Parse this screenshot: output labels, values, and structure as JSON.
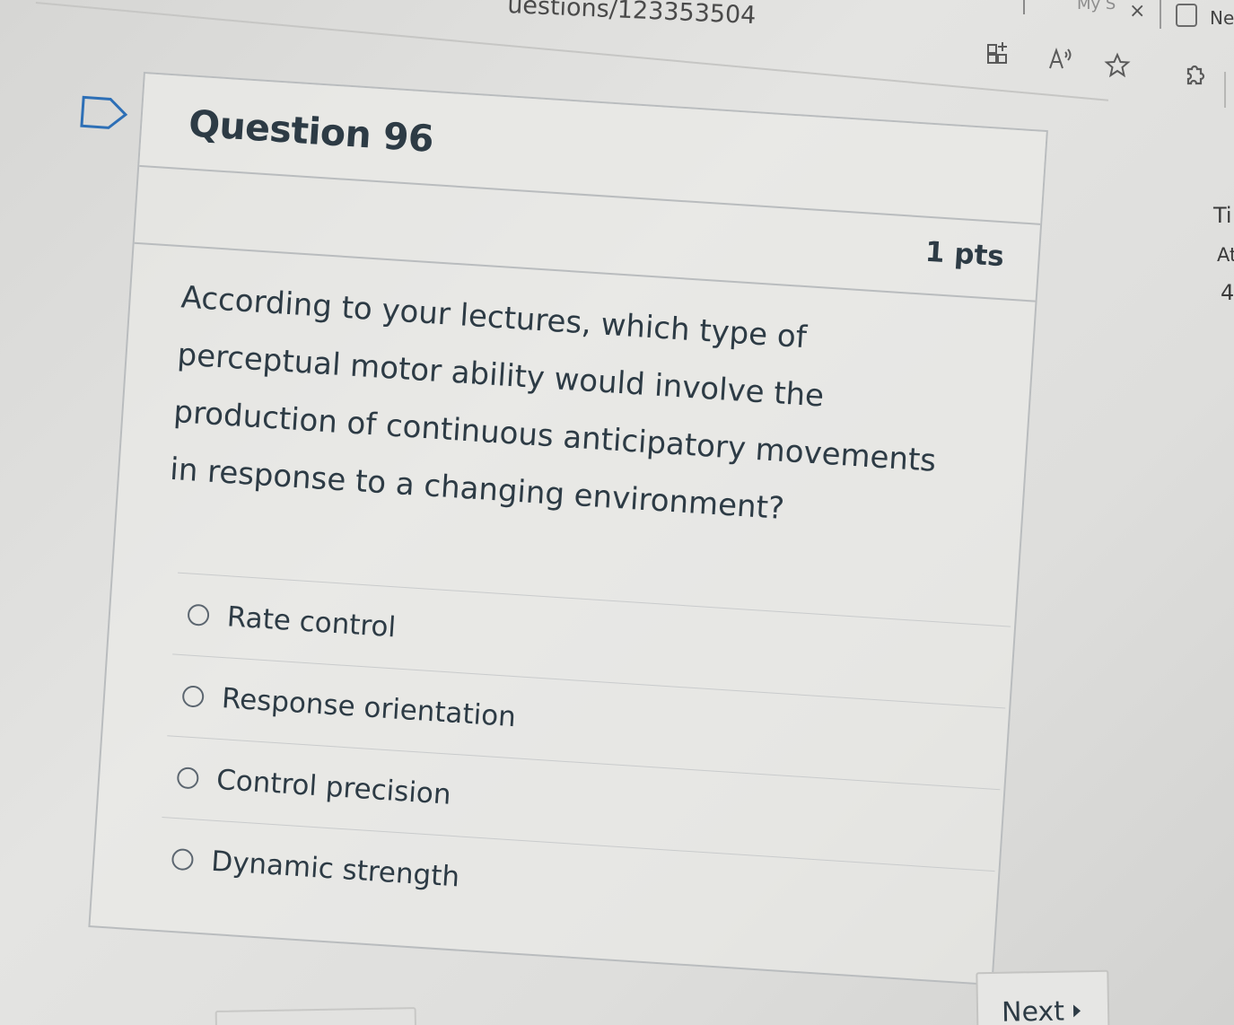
{
  "browser": {
    "url_fragment": "uestions/123353504",
    "tab_label_fragment": "My S",
    "close_glyph": "×",
    "new_tab_label": "Ne"
  },
  "toolbar": {
    "icons": [
      "app-grid-icon",
      "read-aloud-icon",
      "favorite-star-icon",
      "extensions-icon"
    ],
    "read_aloud_glyph": "A"
  },
  "question": {
    "title": "Question 96",
    "points": "1 pts",
    "text": "According to your lectures, which type of perceptual motor ability would involve the production of continuous anticipatory movements in response to a changing environment?",
    "answers": [
      {
        "label": "Rate control",
        "selected": false
      },
      {
        "label": "Response orientation",
        "selected": false
      },
      {
        "label": "Control precision",
        "selected": false
      },
      {
        "label": "Dynamic strength",
        "selected": false
      }
    ]
  },
  "navigation": {
    "next_label": "Next"
  },
  "sidebar": {
    "fragment_1": "Ti",
    "fragment_2": "At",
    "fragment_3": "4"
  },
  "colors": {
    "text": "#2d3b45",
    "border": "#b9bcbe",
    "background": "#dcdcdb"
  }
}
